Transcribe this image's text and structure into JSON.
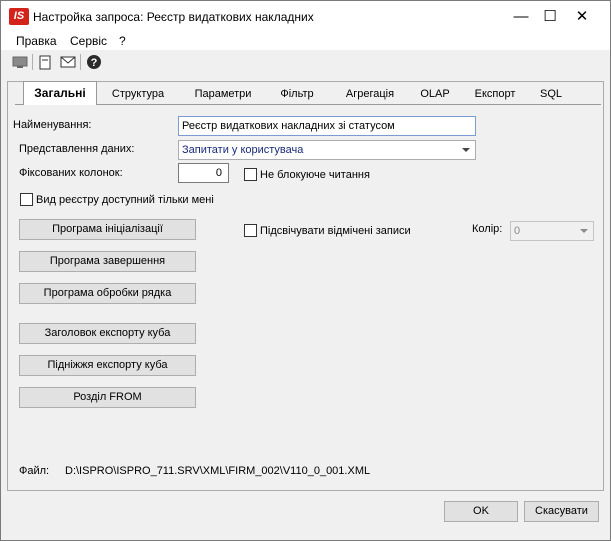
{
  "window": {
    "app_icon_text": "IS",
    "title": "Настройка запроса: Реєстр видаткових накладних",
    "buttons": {
      "minimize": "—",
      "maximize": "☐",
      "close": "✕"
    }
  },
  "menu": [
    "Правка",
    "Сервіс",
    "?"
  ],
  "toolbar": {
    "icons": [
      "monitor-icon",
      "document-icon",
      "mail-icon",
      "help-icon"
    ]
  },
  "tabs": [
    "Загальні",
    "Структура",
    "Параметри",
    "Фільтр",
    "Агрегація",
    "OLAP",
    "Експорт",
    "SQL"
  ],
  "active_tab": "Загальні",
  "form": {
    "name_label": "Найменування:",
    "name_value": "Реєстр видаткових накладних зі статусом",
    "data_view_label": "Представлення даних:",
    "data_view_value": "Запитати у користувача",
    "fixed_columns_label": "Фіксованих колонок:",
    "fixed_columns_value": "0",
    "non_blocking_label": "Не блокуюче читання",
    "non_blocking_checked": false,
    "only_me_label": "Вид реєстру доступний тільки мені",
    "only_me_checked": false,
    "highlight_label": "Підсвічувати відмічені записи",
    "highlight_checked": false,
    "color_label": "Колір:",
    "color_value": "0"
  },
  "buttons": {
    "init_program": "Програма ініціалізації",
    "finish_program": "Програма завершення",
    "row_program": "Програма обробки рядка",
    "cube_header": "Заголовок експорту куба",
    "cube_footer": "Підніжжя експорту куба",
    "from_section": "Розділ FROM",
    "ok": "OK",
    "cancel": "Скасувати"
  },
  "file": {
    "label": "Файл:",
    "path": "D:\\ISPRO\\ISPRO_711.SRV\\XML\\FIRM_002\\V110_0_001.XML"
  }
}
